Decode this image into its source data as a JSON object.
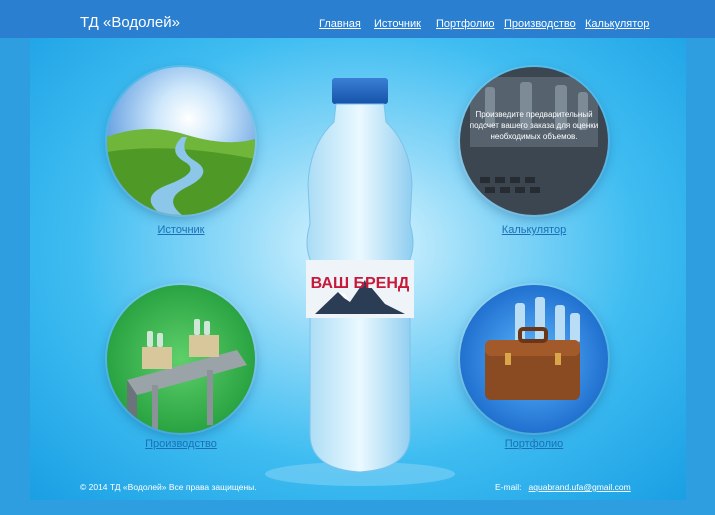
{
  "header": {
    "brand": "ТД «Водолей»",
    "nav": [
      "Главная",
      "Источник",
      "Портфолио",
      "Производство",
      "Калькулятор"
    ]
  },
  "circles": {
    "source_label": "Источник",
    "calculator_label": "Калькулятор",
    "calculator_text": "Произведите предварительный подсчет вашего заказа для оценки необходимых объемов.",
    "production_label": "Производство",
    "portfolio_label": "Портфолио"
  },
  "bottle": {
    "brand_text": "ВАШ БРЕНД"
  },
  "footer": {
    "copyright": "© 2014 ТД «Водолей» Все права защищены.",
    "email_label": "E-mail:",
    "email": "aquabrand.ufa@gmail.com"
  },
  "colors": {
    "header": "#2a7fd0",
    "link": "#1c6fb4",
    "brand_red": "#c8193a"
  }
}
